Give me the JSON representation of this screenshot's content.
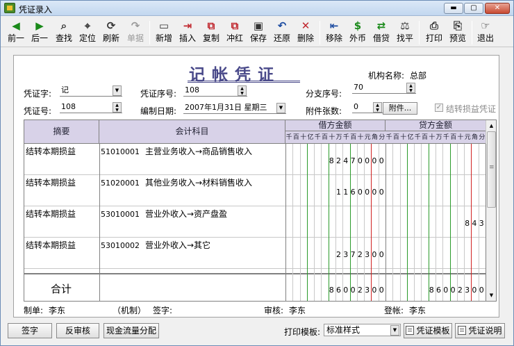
{
  "window": {
    "title": "凭证录入",
    "min": "▬",
    "max": "▢",
    "close": "✕"
  },
  "toolbar": [
    {
      "name": "prev",
      "label": "前一",
      "icon": "◀",
      "color": "#1a8a1a",
      "enabled": true
    },
    {
      "name": "next",
      "label": "后一",
      "icon": "▶",
      "color": "#1a8a1a",
      "enabled": true
    },
    {
      "name": "find",
      "label": "查找",
      "icon": "⌕",
      "color": "#333",
      "enabled": true
    },
    {
      "name": "locate",
      "label": "定位",
      "icon": "⌖",
      "color": "#333",
      "enabled": true
    },
    {
      "name": "refresh",
      "label": "刷新",
      "icon": "⟳",
      "color": "#333",
      "enabled": true
    },
    {
      "name": "single",
      "label": "单据",
      "icon": "↷",
      "color": "#9a9a9a",
      "enabled": false
    },
    {
      "name": "add",
      "label": "新增",
      "icon": "▭",
      "color": "#333",
      "enabled": true
    },
    {
      "name": "insert",
      "label": "插入",
      "icon": "⇥",
      "color": "#c0262d",
      "enabled": true
    },
    {
      "name": "copy",
      "label": "复制",
      "icon": "⧉",
      "color": "#c0262d",
      "enabled": true
    },
    {
      "name": "reverse",
      "label": "冲红",
      "icon": "⧉",
      "color": "#c0262d",
      "enabled": true
    },
    {
      "name": "save",
      "label": "保存",
      "icon": "▣",
      "color": "#333",
      "enabled": true
    },
    {
      "name": "restore",
      "label": "还原",
      "icon": "↶",
      "color": "#1a4aa0",
      "enabled": true
    },
    {
      "name": "delete",
      "label": "删除",
      "icon": "✕",
      "color": "#c0262d",
      "enabled": true
    },
    {
      "name": "remove",
      "label": "移除",
      "icon": "⇤",
      "color": "#1a4aa0",
      "enabled": true
    },
    {
      "name": "forex",
      "label": "外币",
      "icon": "$",
      "color": "#1a8a1a",
      "enabled": true
    },
    {
      "name": "dc",
      "label": "借贷",
      "icon": "⇄",
      "color": "#1a8a1a",
      "enabled": true
    },
    {
      "name": "balance",
      "label": "找平",
      "icon": "⚖",
      "color": "#333",
      "enabled": true
    },
    {
      "name": "print",
      "label": "打印",
      "icon": "⎙",
      "color": "#333",
      "enabled": true
    },
    {
      "name": "preview",
      "label": "预览",
      "icon": "⎘",
      "color": "#333",
      "enabled": true
    },
    {
      "name": "exit",
      "label": "退出",
      "icon": "☞",
      "color": "#333",
      "enabled": true
    }
  ],
  "voucher": {
    "title": "记帐凭证",
    "org_label": "机构名称:",
    "org_value": "总部",
    "type_label": "凭证字:",
    "type_value": "记",
    "seq_label": "凭证序号:",
    "seq_value": "108",
    "branch_label": "分支序号:",
    "branch_value": "70",
    "no_label": "凭证号:",
    "no_value": "108",
    "date_label": "编制日期:",
    "date_value": "2007年1月31日 星期三",
    "attach_label": "附件张数:",
    "attach_value": "0",
    "attach_button": "附件...",
    "carry_label": "结转损益凭证",
    "carry_checked": true
  },
  "grid": {
    "headers": {
      "summary": "摘要",
      "account": "会计科目",
      "debit": "借方金额",
      "credit": "贷方金额"
    },
    "digits": [
      "千",
      "百",
      "十",
      "亿",
      "千",
      "百",
      "十",
      "万",
      "千",
      "百",
      "十",
      "元",
      "角",
      "分"
    ],
    "rows": [
      {
        "summary": "结转本期损益",
        "code": "51010001",
        "account": "主营业务收入→商品销售收入",
        "debit": "82470000",
        "credit": ""
      },
      {
        "summary": "结转本期损益",
        "code": "51020001",
        "account": "其他业务收入→材料销售收入",
        "debit": "1160000",
        "credit": ""
      },
      {
        "summary": "结转本期损益",
        "code": "53010001",
        "account": "营业外收入→资产盘盈",
        "debit": "",
        "credit": "843"
      },
      {
        "summary": "结转本期损益",
        "code": "53010002",
        "account": "营业外收入→其它",
        "debit": "2372300",
        "credit": ""
      }
    ],
    "total_label": "合计",
    "total_debit": "86002300",
    "total_credit": "86002300"
  },
  "footer": {
    "maker_label": "制单:",
    "maker": "李东",
    "mech": "（机制）",
    "sign_label": "签字:",
    "sign": "",
    "audit_label": "审核:",
    "audit": "李东",
    "post_label": "登帐:",
    "post": "李东"
  },
  "bottom": {
    "sign_btn": "签字",
    "unaudit_btn": "反审核",
    "cashflow_btn": "现金流量分配",
    "template_label": "打印模板:",
    "template_value": "标准样式",
    "voucher_template_btn": "凭证模板",
    "voucher_desc_btn": "凭证说明"
  },
  "colors": {
    "grid_header": "#d8d2e8",
    "money_line": "#2a9a2a",
    "yuan_line": "#d02020"
  }
}
